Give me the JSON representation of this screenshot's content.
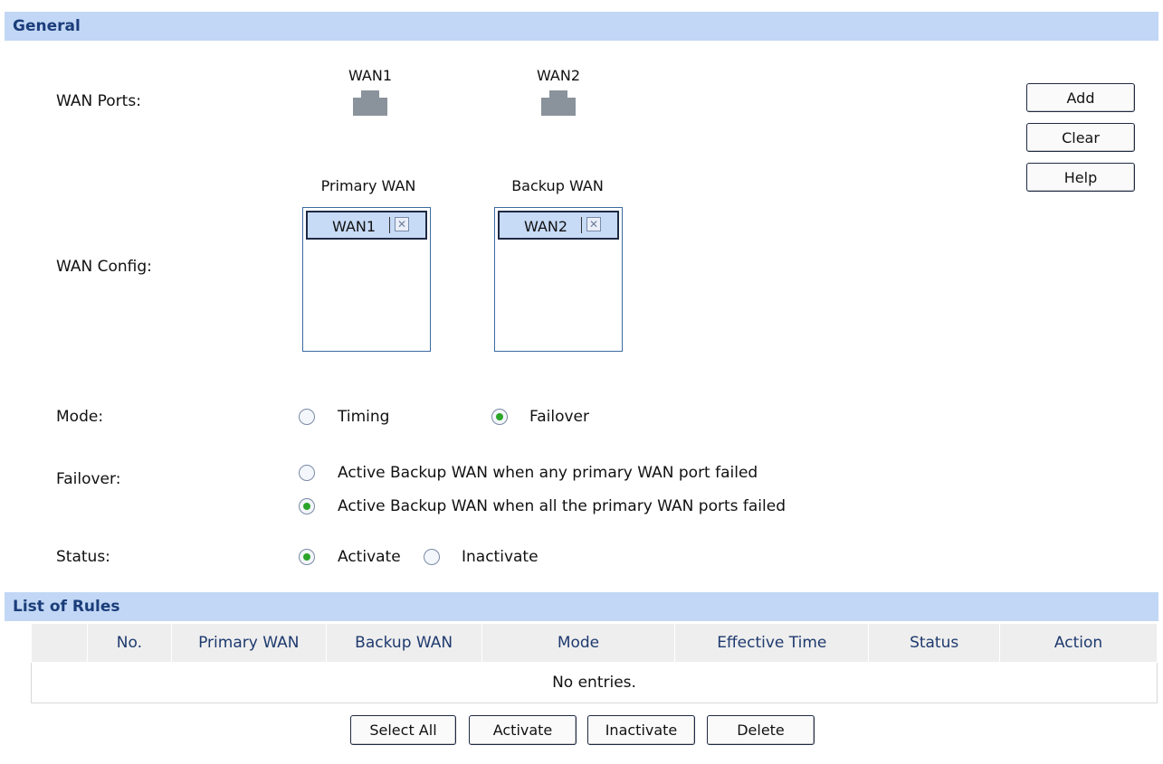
{
  "general": {
    "title": "General",
    "wan_ports": {
      "label": "WAN Ports:",
      "ports": [
        "WAN1",
        "WAN2"
      ]
    },
    "buttons": {
      "add": "Add",
      "clear": "Clear",
      "help": "Help"
    },
    "wan_config": {
      "label": "WAN Config:",
      "primary": {
        "title": "Primary WAN",
        "items": [
          "WAN1"
        ]
      },
      "backup": {
        "title": "Backup WAN",
        "items": [
          "WAN2"
        ]
      }
    },
    "mode": {
      "label": "Mode:",
      "options": [
        {
          "label": "Timing",
          "selected": false
        },
        {
          "label": "Failover",
          "selected": true
        }
      ]
    },
    "failover": {
      "label": "Failover:",
      "options": [
        {
          "label": "Active Backup WAN when any primary WAN port failed",
          "selected": false
        },
        {
          "label": "Active Backup WAN when all the primary WAN ports failed",
          "selected": true
        }
      ]
    },
    "status": {
      "label": "Status:",
      "options": [
        {
          "label": "Activate",
          "selected": true
        },
        {
          "label": "Inactivate",
          "selected": false
        }
      ]
    }
  },
  "rules": {
    "title": "List of Rules",
    "columns": [
      "No.",
      "Primary WAN",
      "Backup WAN",
      "Mode",
      "Effective Time",
      "Status",
      "Action"
    ],
    "empty_text": "No entries.",
    "buttons": {
      "select_all": "Select All",
      "activate": "Activate",
      "inactivate": "Inactivate",
      "delete": "Delete"
    }
  },
  "colors": {
    "section_header_bg": "#c2d7f5",
    "section_header_text": "#1b3d7a",
    "radio_selected": "#2aa52a",
    "chip_bg": "#c7daf6"
  }
}
